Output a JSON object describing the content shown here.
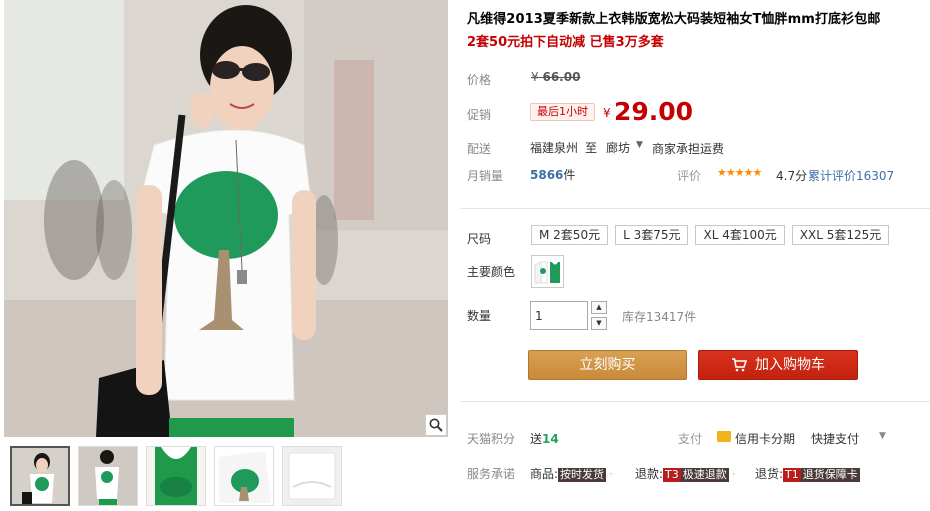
{
  "product": {
    "title": "凡维得2013夏季新款上衣韩版宽松大码装短袖女T恤胖mm打底衫包邮",
    "subtitle": "2套50元拍下自动减 已售3万多套"
  },
  "price": {
    "label": "价格",
    "currency": "¥",
    "original": "66.00",
    "promo_label": "促销",
    "promo_tag": "最后1小时",
    "current": "29.00"
  },
  "shipping": {
    "label": "配送",
    "from": "福建泉州",
    "to_word": "至",
    "destination": "廊坊",
    "fee": "商家承担运费"
  },
  "sales": {
    "label": "月销量",
    "count": "5866",
    "unit": "件",
    "rating_label": "评价",
    "stars": "★★★★★",
    "score": "4.7分",
    "reviews": "累计评价16307"
  },
  "sku": {
    "size_label": "尺码",
    "sizes": [
      "M 2套50元",
      "L 3套75元",
      "XL 4套100元",
      "XXL 5套125元"
    ],
    "color_label": "主要颜色",
    "qty_label": "数量",
    "qty_value": "1",
    "stock": "库存13417件"
  },
  "actions": {
    "buy": "立刻购买",
    "cart": "加入购物车"
  },
  "points": {
    "label": "天猫积分",
    "prefix": "送",
    "value": "14"
  },
  "payment": {
    "label": "支付",
    "credit": "信用卡分期",
    "fast": "快捷支付"
  },
  "service": {
    "label": "服务承诺",
    "goods_label": "商品:",
    "goods_tag": "按时发货",
    "refund_label": "退款:",
    "refund_tag_code": "T3",
    "refund_tag": "极速退款",
    "return_label": "退货:",
    "return_tag_code": "T1",
    "return_tag": "退货保障卡"
  },
  "colors": {
    "price_red": "#c40000",
    "buy_orange": "#c98a3a",
    "cart_red": "#c3220f",
    "link_blue": "#3c6fa8",
    "shirt_green": "#1f9a5a"
  }
}
